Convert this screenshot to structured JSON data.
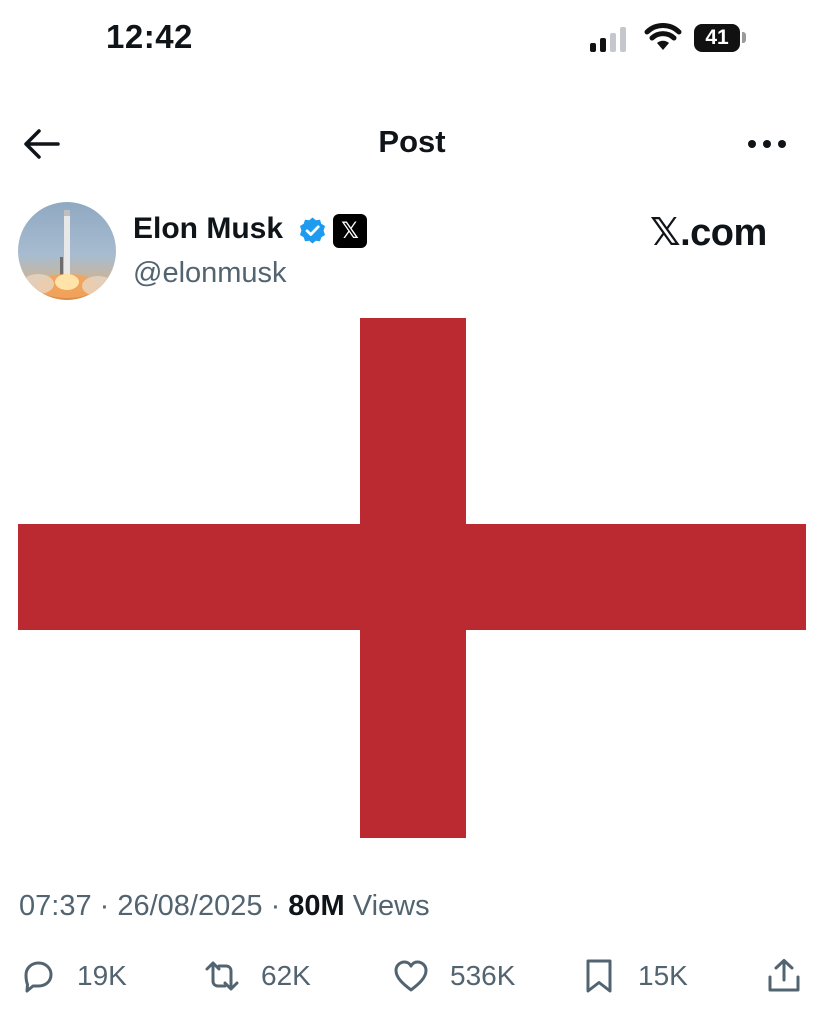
{
  "status_bar": {
    "time": "12:42",
    "battery": "41"
  },
  "header": {
    "title": "Post",
    "back_icon": "arrow-left-icon",
    "more_icon": "more-horizontal-icon"
  },
  "author": {
    "name": "Elon Musk",
    "handle": "@elonmusk",
    "affiliate_badge": "𝕏",
    "verified_color": "#1d9bf0"
  },
  "watermark": "𝕏.com",
  "media": {
    "description_icon": "st-george-cross-flag",
    "cross_color": "#bb2a31",
    "background_color": "#ffffff"
  },
  "meta": {
    "time": "07:37",
    "separator": " · ",
    "date": "26/08/2025",
    "views_count": "80M",
    "views_label": " Views"
  },
  "actions": {
    "reply": {
      "icon": "reply-icon",
      "count": "19K"
    },
    "repost": {
      "icon": "repost-icon",
      "count": "62K"
    },
    "like": {
      "icon": "heart-icon",
      "count": "536K"
    },
    "bookmark": {
      "icon": "bookmark-icon",
      "count": "15K"
    },
    "share": {
      "icon": "share-icon"
    }
  }
}
